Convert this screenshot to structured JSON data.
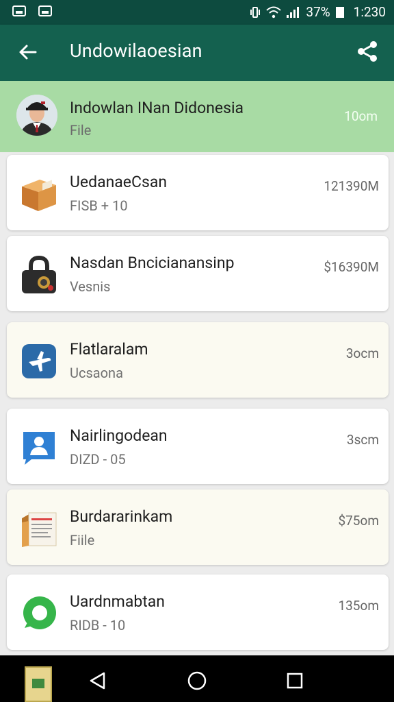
{
  "status_bar": {
    "battery": "37%",
    "time": "1:230"
  },
  "app_bar": {
    "title": "Undowilaoesian"
  },
  "header_item": {
    "title": "Indowlan INan Didonesia",
    "subtitle": "File",
    "meta": "10om"
  },
  "items": [
    {
      "title": "UedanaeCsan",
      "subtitle": "FISB + 10",
      "meta": "121390M",
      "icon": "package-icon"
    },
    {
      "title": "Nasdan Bncicianansinp",
      "subtitle": "Vesnis",
      "meta": "$16390M",
      "icon": "lock-icon"
    },
    {
      "title": "Flatlaralam",
      "subtitle": "Ucsaona",
      "meta": "3ocm",
      "icon": "airplane-icon"
    },
    {
      "title": "Nairlingodean",
      "subtitle": "DIZD - 05",
      "meta": "3scm",
      "icon": "contact-icon"
    },
    {
      "title": "Burdararinkam",
      "subtitle": "Fiile",
      "meta": "$75om",
      "icon": "document-folder-icon"
    },
    {
      "title": "Uardnmabtan",
      "subtitle": "RIDB - 10",
      "meta": "135om",
      "icon": "chat-bubble-icon"
    }
  ],
  "colors": {
    "status_bar": "#0d4b3f",
    "app_bar": "#14614f",
    "header_highlight": "#a8dba4"
  }
}
